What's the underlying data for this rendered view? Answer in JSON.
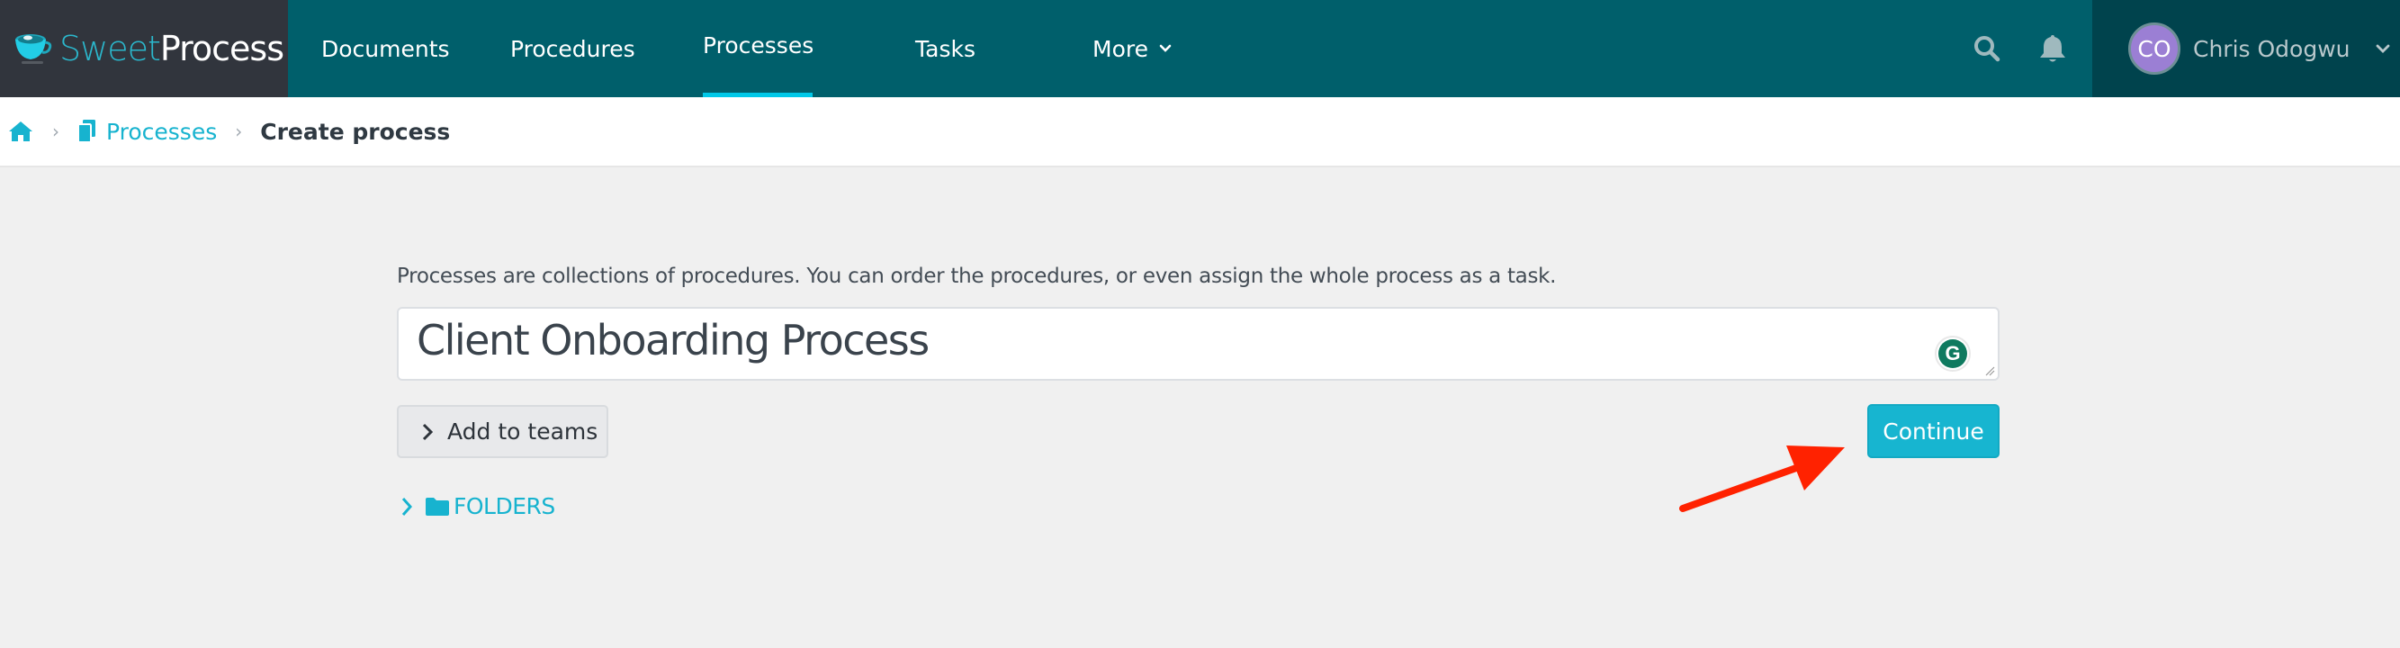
{
  "app": {
    "brand_part1": "Sweet",
    "brand_part2": "Process"
  },
  "nav": {
    "items": [
      {
        "label": "Documents",
        "active": false
      },
      {
        "label": "Procedures",
        "active": false
      },
      {
        "label": "Processes",
        "active": true
      },
      {
        "label": "Tasks",
        "active": false
      },
      {
        "label": "More",
        "active": false,
        "has_dropdown": true
      }
    ],
    "search_icon": "search-icon",
    "notification_icon": "bell-icon"
  },
  "user": {
    "initials": "CO",
    "name": "Chris Odogwu",
    "avatar_color": "#9b7fd4"
  },
  "breadcrumb": {
    "home_icon": "home-icon",
    "items": [
      {
        "label": "Processes",
        "icon": "copy-icon",
        "link": true
      },
      {
        "label": "Create process",
        "link": false
      }
    ]
  },
  "form": {
    "intro_text": "Processes are collections of procedures. You can order the procedures, or even assign the whole process as a task.",
    "title_value": "Client Onboarding Process",
    "grammarly_label": "G",
    "add_to_teams_label": "Add to teams",
    "continue_label": "Continue",
    "folders_label": "FOLDERS"
  },
  "annotation": {
    "arrow_color": "#ff2200",
    "points_to": "continue-button"
  },
  "colors": {
    "topbar": "#005f6b",
    "logo_panel": "#31353d",
    "user_panel": "#00434d",
    "accent": "#17b5d0",
    "active_tab_indicator": "#00c8e8"
  }
}
